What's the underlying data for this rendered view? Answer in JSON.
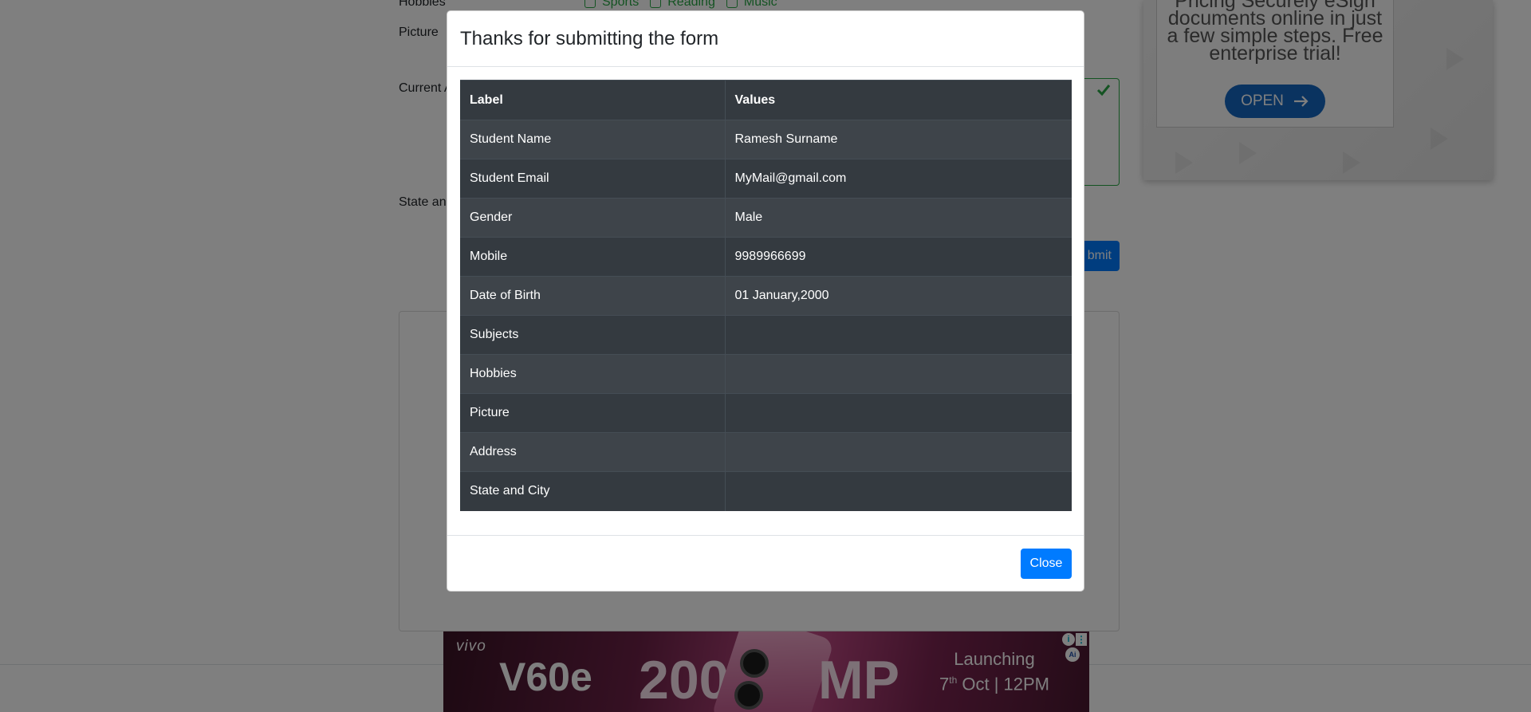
{
  "background_form": {
    "labels": {
      "hobbies": "Hobbies",
      "picture": "Picture",
      "current_address": "Current A",
      "state_and_city": "State and"
    },
    "hobbies_options": [
      "Sports",
      "Reading",
      "Music"
    ],
    "submit_label": "bmit"
  },
  "right_ad": {
    "text": "Pricing Securely eSign documents online in just a few simple steps. Free enterprise trial!",
    "button_label": "OPEN"
  },
  "bottom_ad": {
    "brand": "vivo",
    "model": "V60e",
    "megapixel_left": "200",
    "megapixel_right": "MP",
    "launch_line1": "Launching",
    "launch_day": "7",
    "launch_day_suffix": "th",
    "launch_line2_rest": "Oct | 12PM",
    "info_glyph": "i",
    "menu_glyph": "⋮",
    "ad_choice_glyph": "Ai"
  },
  "modal": {
    "title": "Thanks for submitting the form",
    "table": {
      "headers": [
        "Label",
        "Values"
      ],
      "rows": [
        {
          "label": "Student Name",
          "value": "Ramesh Surname"
        },
        {
          "label": "Student Email",
          "value": "MyMail@gmail.com"
        },
        {
          "label": "Gender",
          "value": "Male"
        },
        {
          "label": "Mobile",
          "value": "9989966699"
        },
        {
          "label": "Date of Birth",
          "value": "01 January,2000"
        },
        {
          "label": "Subjects",
          "value": ""
        },
        {
          "label": "Hobbies",
          "value": ""
        },
        {
          "label": "Picture",
          "value": ""
        },
        {
          "label": "Address",
          "value": ""
        },
        {
          "label": "State and City",
          "value": ""
        }
      ]
    },
    "close_label": "Close"
  },
  "colors": {
    "primary": "#007bff",
    "table_dark": "#343a40",
    "table_stripe": "#3e444a",
    "valid_green": "#28a745",
    "backdrop": "rgba(0,0,0,0.5)"
  }
}
